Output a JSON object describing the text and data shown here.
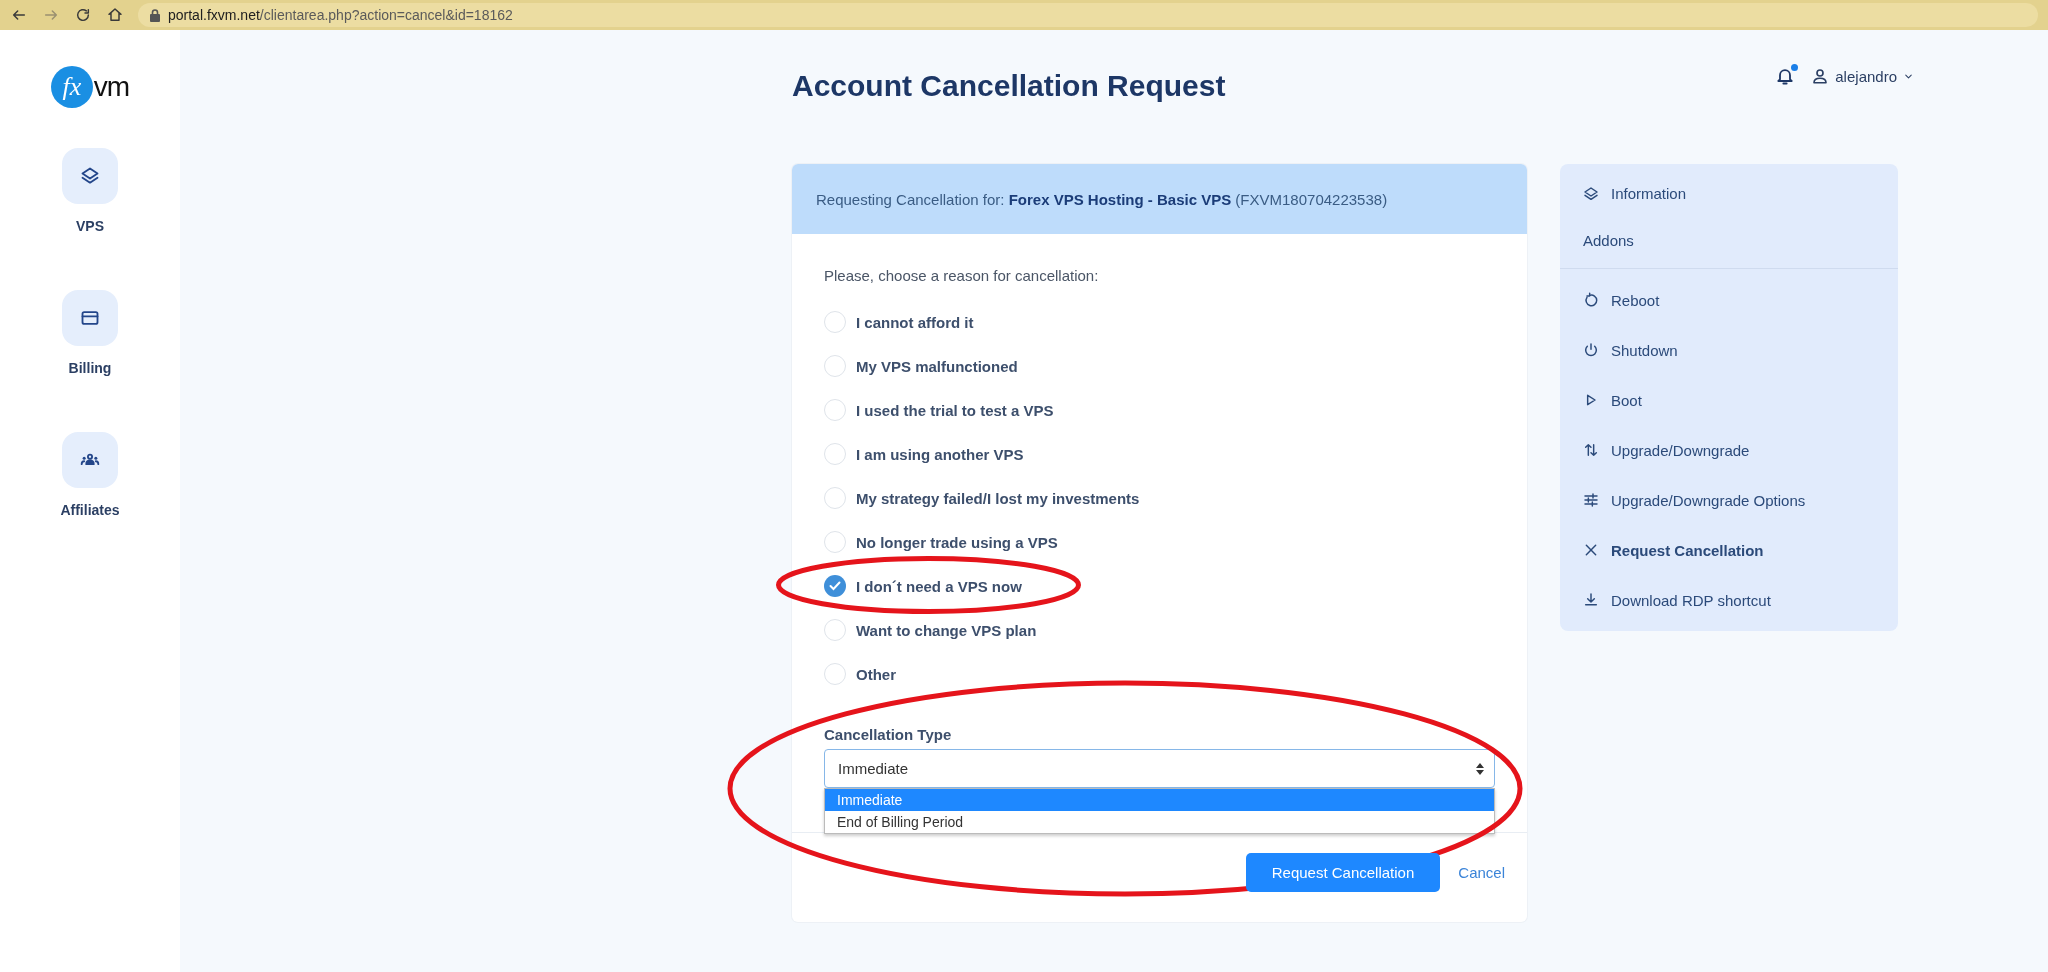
{
  "browser": {
    "back_enabled": true,
    "forward_enabled": false,
    "url_host": "portal.fxvm.net",
    "url_path": "/clientarea.php?action=cancel&id=18162"
  },
  "logo": {
    "mark": "fx",
    "name": "vm"
  },
  "sidebar": {
    "items": [
      {
        "label": "VPS",
        "kind": "layers"
      },
      {
        "label": "Billing",
        "kind": "card"
      },
      {
        "label": "Affiliates",
        "kind": "people"
      }
    ]
  },
  "header": {
    "title": "Account Cancellation Request",
    "notifications": {
      "unread": true
    },
    "user": {
      "name": "alejandro"
    }
  },
  "card": {
    "request": "Requesting Cancellation for: **Forex VPS Hosting - Basic VPS** (FXVM180704223538)",
    "prompt": "Please, choose a reason for cancellation:",
    "reasons": [
      {
        "label": "I cannot afford it",
        "selected": false,
        "highlighted": false
      },
      {
        "label": "My VPS malfunctioned",
        "selected": false,
        "highlighted": false
      },
      {
        "label": "I used the trial to test a VPS",
        "selected": false,
        "highlighted": false
      },
      {
        "label": "I am using another VPS",
        "selected": false,
        "highlighted": false
      },
      {
        "label": "My strategy failed/I lost my investments",
        "selected": false,
        "highlighted": false
      },
      {
        "label": "No longer trade using a VPS",
        "selected": false,
        "highlighted": false
      },
      {
        "label": "I don´t need a VPS now",
        "selected": true,
        "highlighted": true
      },
      {
        "label": "Want to change VPS plan",
        "selected": false,
        "highlighted": false
      },
      {
        "label": "Other",
        "selected": false,
        "highlighted": false
      }
    ],
    "type_label": "Cancellation Type",
    "type_select": {
      "value": "Immediate",
      "expanded": true,
      "highlighted": true,
      "options": [
        {
          "label": "Immediate",
          "selected": true
        },
        {
          "label": "End of Billing Period",
          "selected": false
        }
      ]
    },
    "submit": "Request Cancellation",
    "cancel": "Cancel"
  },
  "actions": {
    "top": [
      {
        "label": "Information",
        "kind": "layers",
        "selected": false
      },
      {
        "label": "Addons",
        "kind": "none",
        "selected": false
      }
    ],
    "items": [
      {
        "label": "Reboot",
        "kind": "reboot",
        "selected": false
      },
      {
        "label": "Shutdown",
        "kind": "power",
        "selected": false
      },
      {
        "label": "Boot",
        "kind": "play",
        "selected": false
      },
      {
        "label": "Upgrade/Downgrade",
        "kind": "updown",
        "selected": false
      },
      {
        "label": "Upgrade/Downgrade Options",
        "kind": "sliders",
        "selected": false
      },
      {
        "label": "Request Cancellation",
        "kind": "close",
        "selected": true
      },
      {
        "label": "Download RDP shortcut",
        "kind": "download",
        "selected": false
      }
    ]
  }
}
